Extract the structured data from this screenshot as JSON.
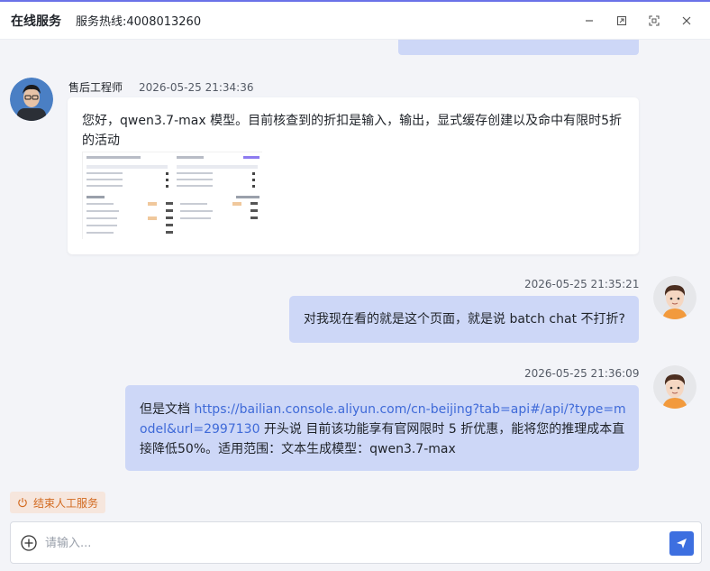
{
  "header": {
    "title": "在线服务",
    "hotline": "服务热线:4008013260",
    "controls": [
      "minimize-icon",
      "restore-icon",
      "fullscreen-icon",
      "close-icon"
    ]
  },
  "messages": [
    {
      "sender": "售后工程师",
      "time": "2026-05-25 21:34:36",
      "side": "left",
      "text": "您好，qwen3.7-max 模型。目前核查到的折扣是输入，输出，显式缓存创建以及命中有限时5折的活动",
      "has_image": true
    },
    {
      "time": "2026-05-25 21:35:21",
      "side": "right",
      "text": "对我现在看的就是这个页面，就是说 batch chat 不打折?"
    },
    {
      "time": "2026-05-25 21:36:09",
      "side": "right",
      "text_before": "但是文档 ",
      "link": "https://bailian.console.aliyun.com/cn-beijing?tab=api#/api/?type=model&url=2997130",
      "text_after": " 开头说 目前该功能享有官网限时 5 折优惠，能将您的推理成本直接降低50%。适用范围：文本生成模型：qwen3.7-max"
    }
  ],
  "end_service_label": "结束人工服务",
  "input": {
    "placeholder": "请输入...",
    "value": ""
  },
  "colors": {
    "accent": "#3d6fe0",
    "user_bubble": "#cdd7f7",
    "end_service_text": "#d2691e",
    "link": "#3f6ad8"
  }
}
